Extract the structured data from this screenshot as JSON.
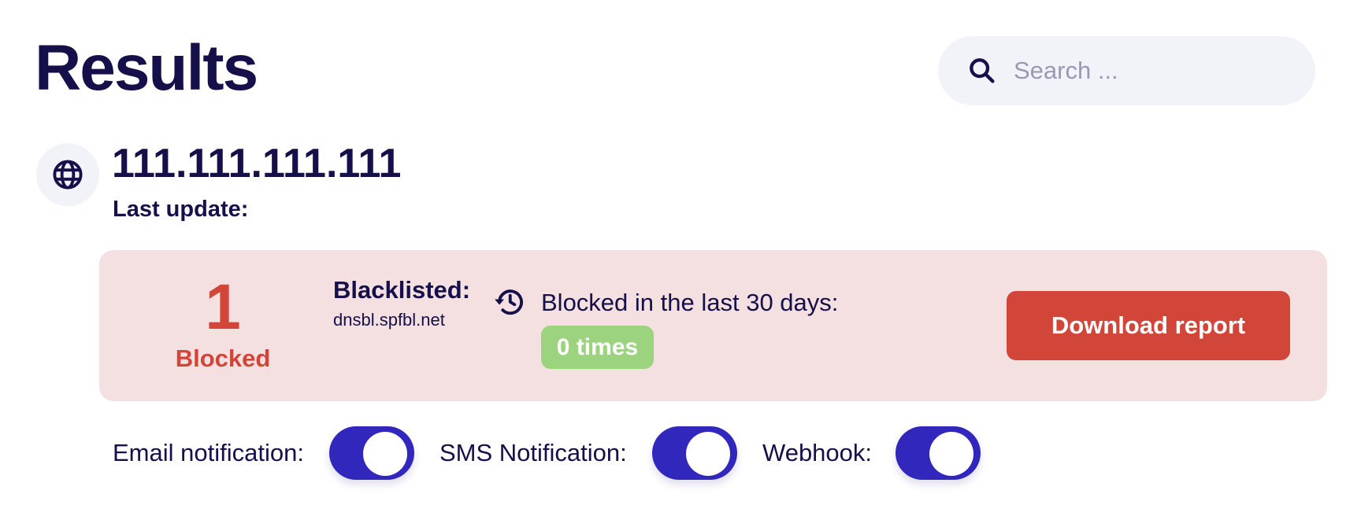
{
  "header": {
    "title": "Results",
    "search": {
      "placeholder": "Search ...",
      "value": "",
      "icon": "search-icon"
    }
  },
  "target": {
    "icon": "globe-icon",
    "ip": "111.111.111.111",
    "last_update_label": "Last update:",
    "last_update_value": ""
  },
  "summary_card": {
    "background": "#F5E0E1",
    "blocked_count": "1",
    "blocked_label": "Blocked",
    "blacklisted_label": "Blacklisted:",
    "blacklisted_value": "dnsbl.spfbl.net",
    "history_icon": "history-icon",
    "history_label": "Blocked in the last 30 days:",
    "history_badge": "0 times",
    "download_label": "Download report"
  },
  "notifications": [
    {
      "label": "Email notification:",
      "enabled": true
    },
    {
      "label": "SMS Notification:",
      "enabled": true
    },
    {
      "label": "Webhook:",
      "enabled": true
    }
  ],
  "colors": {
    "text_primary": "#150F4A",
    "danger": "#D2463A",
    "success_badge": "#9BD37F",
    "toggle_on": "#3127BD",
    "search_bg": "#F2F3F9"
  }
}
